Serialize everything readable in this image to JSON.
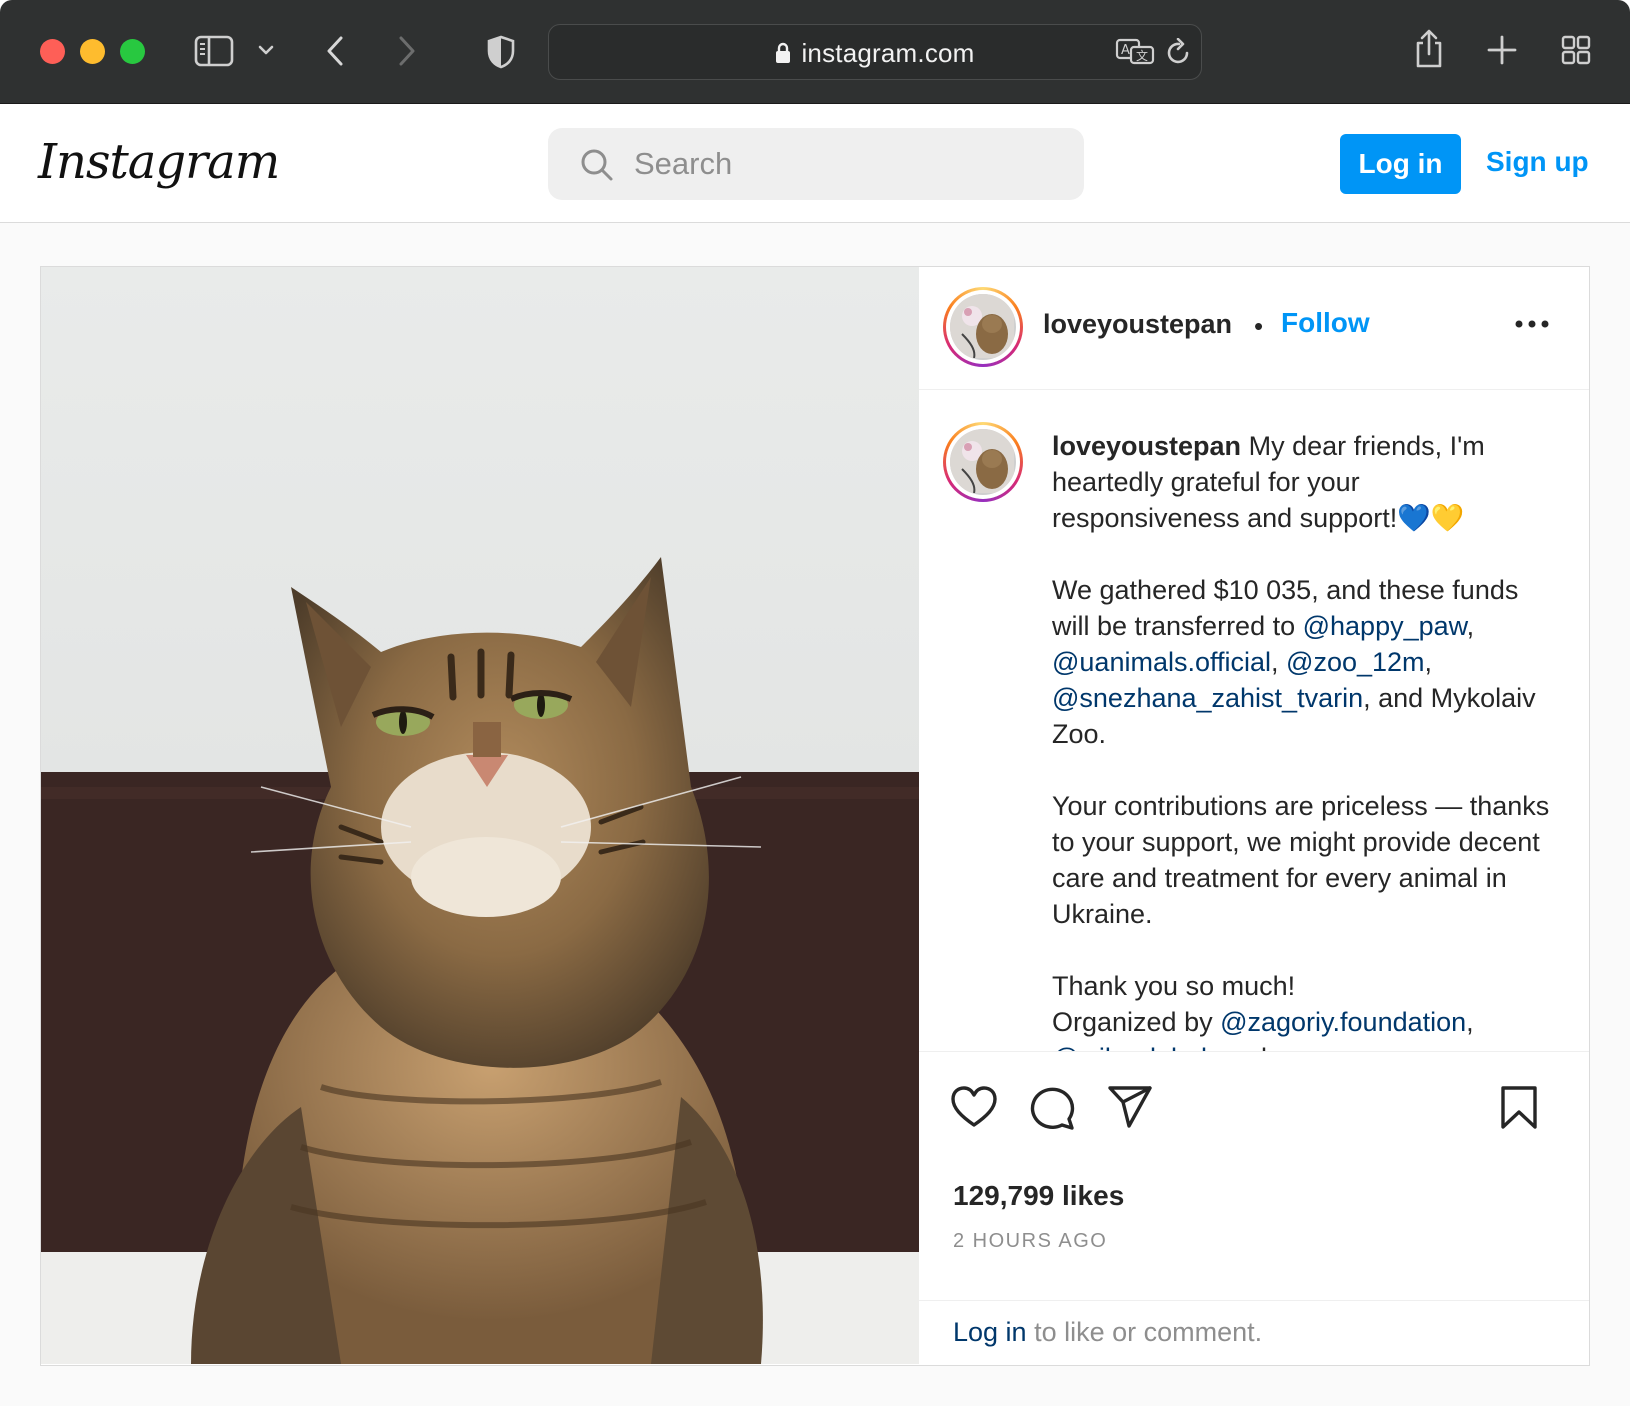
{
  "browser": {
    "url": "instagram.com",
    "icons": [
      "sidebar-icon",
      "chevron-down-icon",
      "back-icon",
      "forward-icon",
      "shield-icon",
      "lock-icon",
      "translate-icon",
      "reload-icon",
      "share-icon",
      "new-tab-icon",
      "tab-overview-icon"
    ]
  },
  "header": {
    "logo": "Instagram",
    "search_placeholder": "Search",
    "login_label": "Log in",
    "signup_label": "Sign up"
  },
  "post": {
    "username": "loveyoustepan",
    "separator": "•",
    "follow_label": "Follow",
    "more_label": "...",
    "caption": {
      "author": "loveyoustepan",
      "p1": "My dear friends, I'm heartedly grateful for your responsiveness and support!",
      "heart_blue": "💙",
      "heart_yellow": "💛",
      "p2_a": "We gathered $10 035, and these funds will be transferred to ",
      "mention_1": "@happy_paw",
      "comma": ",",
      "mention_2": "@uanimals.official",
      "comma_space": ", ",
      "mention_3": "@zoo_12m",
      "mention_4": "@snezhana_zahist_tvarin",
      "p2_b": ", and Mykolaiv Zoo.",
      "p3": "Your contributions are priceless — thanks to your support, we might provide decent care and treatment for every animal in Ukraine.",
      "p4_a": "Thank you so much!",
      "p4_b": "Organized by ",
      "mention_5": "@zagoriy.foundation",
      "mention_6": "@wibaglobal",
      "p4_c": ", and me"
    },
    "likes": "129,799 likes",
    "time": "2 HOURS AGO",
    "comment_prompt_link": "Log in",
    "comment_prompt_rest": " to like or comment."
  },
  "colors": {
    "accent": "#0095f6",
    "mention": "#00376b",
    "toolbar": "#2f3131"
  }
}
